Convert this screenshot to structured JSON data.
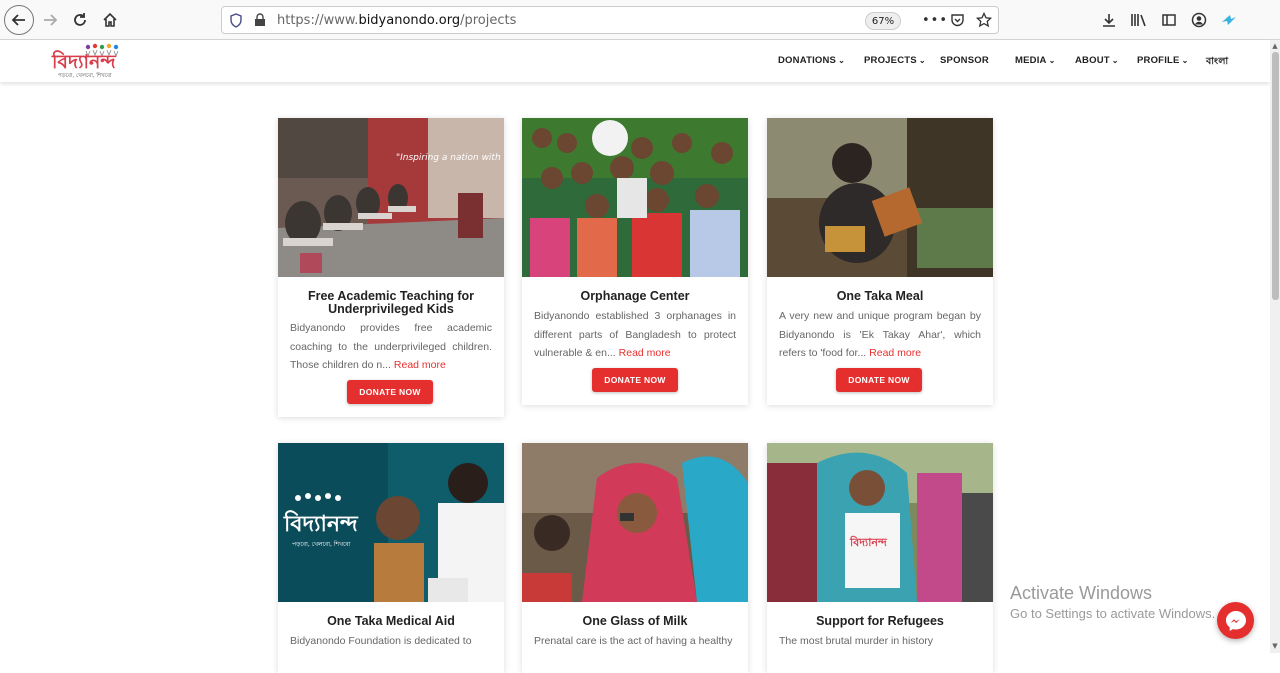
{
  "browser": {
    "url_prefix": "https://www.",
    "url_domain": "bidyanondo.org",
    "url_path": "/projects",
    "zoom": "67%"
  },
  "site": {
    "logo_text": "বিদ্যানন্দ",
    "logo_tagline": "পড়বো, খেলবো, শিখবো",
    "brand_color": "#e52e2e",
    "menu": [
      {
        "label": "DONATIONS",
        "dropdown": true
      },
      {
        "label": "PROJECTS",
        "dropdown": true
      },
      {
        "label": "SPONSOR",
        "dropdown": false
      },
      {
        "label": "MEDIA",
        "dropdown": true
      },
      {
        "label": "ABOUT",
        "dropdown": true
      },
      {
        "label": "PROFILE",
        "dropdown": true
      },
      {
        "label": "বাংলা",
        "dropdown": false
      }
    ]
  },
  "projects": [
    {
      "title": "Free Academic Teaching for Underprivileged Kids",
      "desc": "Bidyanondo provides free academic coaching to the underprivileged children. Those children do n...",
      "read_more": "Read more",
      "button": "DONATE NOW"
    },
    {
      "title": "Orphanage Center",
      "desc": "Bidyanondo established 3 orphanages in different parts of Bangladesh to protect vulnerable & en...",
      "read_more": "Read more",
      "button": "DONATE NOW"
    },
    {
      "title": "One Taka Meal",
      "desc": "A very new and unique program began by Bidyanondo is 'Ek Takay Ahar', which refers to 'food for...",
      "read_more": "Read more",
      "button": "DONATE NOW"
    },
    {
      "title": "One Taka Medical Aid",
      "desc": "Bidyanondo Foundation is dedicated to"
    },
    {
      "title": "One Glass of Milk",
      "desc": "Prenatal care is the act of having a healthy"
    },
    {
      "title": "Support for Refugees",
      "desc": "The most brutal murder in history"
    }
  ],
  "image_overlay_text": {
    "banner": "\"Inspiring a nation with food\""
  },
  "windows": {
    "line1": "Activate Windows",
    "line2": "Go to Settings to activate Windows."
  }
}
